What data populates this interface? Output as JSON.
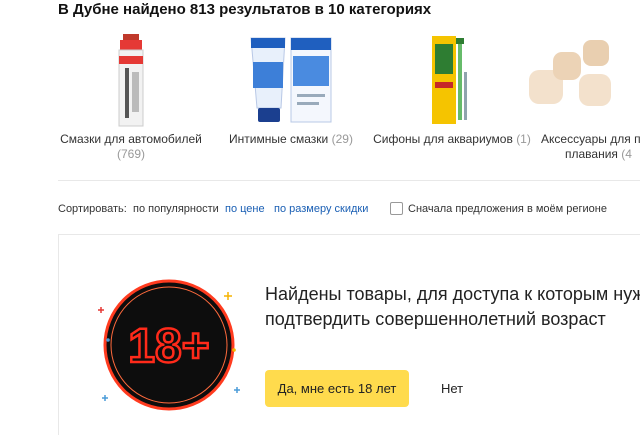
{
  "results_title": "В Дубне найдено 813 результатов в 10 категориях",
  "categories": [
    {
      "name": "Смазки для автомобилей",
      "count": "(769)",
      "icon": "spray-can-icon"
    },
    {
      "name": "Интимные смазки",
      "count": "(29)",
      "icon": "lubricant-tube-icon"
    },
    {
      "name": "Сифоны для аквариумов",
      "count": "(1)",
      "icon": "aquarium-siphon-icon"
    },
    {
      "name": "Аксессуары для по",
      "name_line2": "плавания",
      "count": "(4",
      "icon": "swim-accessories-icon"
    }
  ],
  "sort": {
    "label": "Сортировать:",
    "options": [
      "по популярности",
      "по цене",
      "по размеру скидки"
    ],
    "region_label": "Сначала предложения в моём регионе"
  },
  "age_gate": {
    "badge_text": "18+",
    "message": "Найдены товары, для доступа к которым нужно подтвердить совершеннолетний возраст",
    "confirm_label": "Да, мне есть 18 лет",
    "deny_label": "Нет"
  },
  "colors": {
    "accent_button": "#ffdb4d",
    "link": "#1a5fb4",
    "neon_red": "#ff2a1a"
  }
}
